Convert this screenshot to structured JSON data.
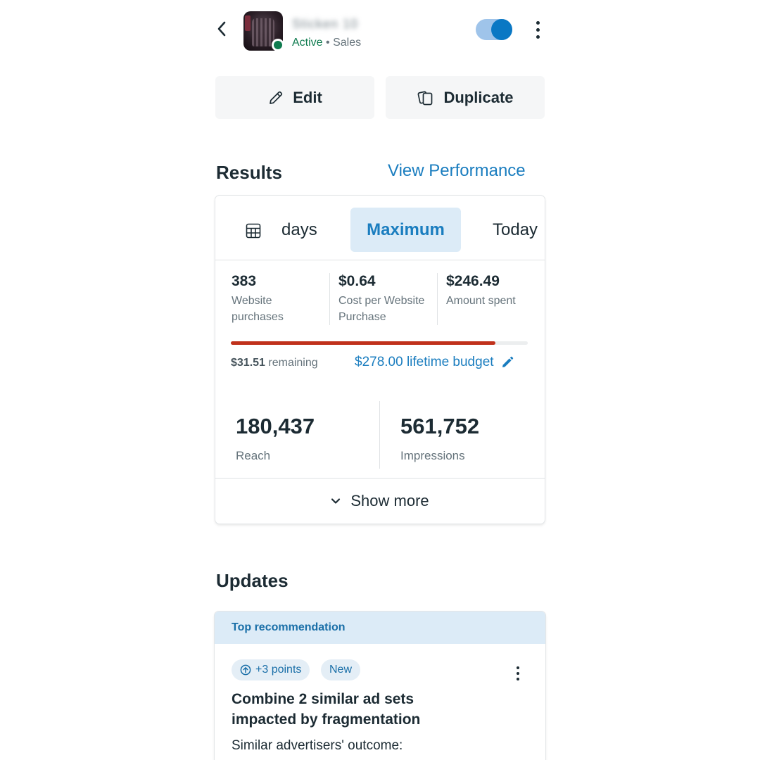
{
  "header": {
    "campaign_name": "Sticken 10",
    "status": "Active",
    "separator": "•",
    "objective": "Sales",
    "toggle_on": true
  },
  "actions": {
    "edit_label": "Edit",
    "duplicate_label": "Duplicate"
  },
  "results": {
    "title": "Results",
    "view_performance": "View Performance",
    "tabs": [
      {
        "label": "days",
        "selected": false
      },
      {
        "label": "Maximum",
        "selected": true
      },
      {
        "label": "Today",
        "selected": false
      }
    ],
    "metrics": [
      {
        "value": "383",
        "label": "Website purchases"
      },
      {
        "value": "$0.64",
        "label": "Cost per Website Purchase"
      },
      {
        "value": "$246.49",
        "label": "Amount spent"
      }
    ],
    "budget_progress": 0.89,
    "remaining_amount": "$31.51",
    "remaining_label": "remaining",
    "budget_label": "$278.00 lifetime budget",
    "reach_value": "180,437",
    "reach_label": "Reach",
    "impressions_value": "561,752",
    "impressions_label": "Impressions",
    "show_more": "Show more"
  },
  "updates": {
    "title": "Updates",
    "header": "Top recommendation",
    "chip_points": "+3 points",
    "chip_new": "New",
    "rec_title": "Combine 2 similar ad sets impacted by fragmentation",
    "rec_sub": "Similar advertisers' outcome:"
  },
  "colors": {
    "accent": "#1a7dbf",
    "active": "#0f7b4f",
    "progress": "#c0311b"
  }
}
